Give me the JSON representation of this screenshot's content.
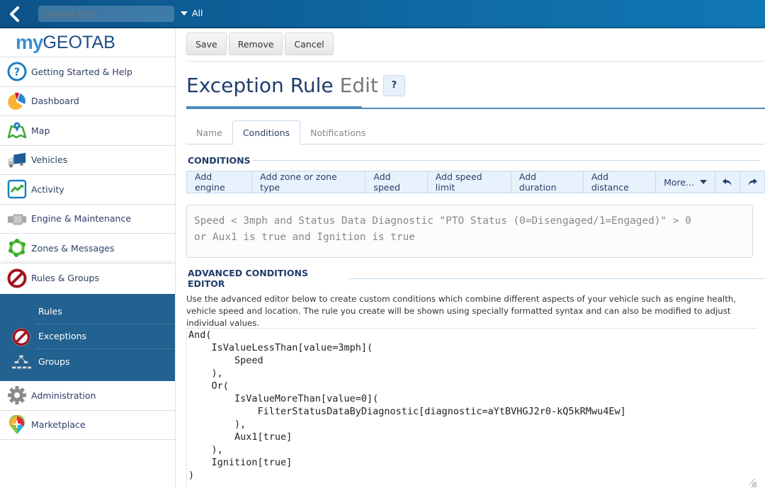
{
  "topbar": {
    "groups_filter_placeholder": "Groups filter",
    "all_label": "All",
    "back_icon": "chevron-left-icon"
  },
  "sidebar": {
    "logo": {
      "my": "my",
      "geotab": "GEOTAB"
    },
    "items": [
      {
        "label": "Getting Started & Help",
        "icon": "help-circle-icon"
      },
      {
        "label": "Dashboard",
        "icon": "pie-chart-icon"
      },
      {
        "label": "Map",
        "icon": "map-pin-icon"
      },
      {
        "label": "Vehicles",
        "icon": "truck-icon"
      },
      {
        "label": "Activity",
        "icon": "activity-chart-icon"
      },
      {
        "label": "Engine & Maintenance",
        "icon": "engine-icon"
      },
      {
        "label": "Zones & Messages",
        "icon": "zone-icon"
      },
      {
        "label": "Rules & Groups",
        "icon": "prohibited-icon"
      }
    ],
    "subitems": [
      {
        "label": "Rules",
        "icon": ""
      },
      {
        "label": "Exceptions",
        "icon": "prohibited-icon"
      },
      {
        "label": "Groups",
        "icon": "hierarchy-icon"
      }
    ],
    "bottom_items": [
      {
        "label": "Administration",
        "icon": "gear-icon"
      },
      {
        "label": "Marketplace",
        "icon": "marketplace-icon"
      }
    ]
  },
  "toolbar": {
    "save_label": "Save",
    "remove_label": "Remove",
    "cancel_label": "Cancel"
  },
  "page": {
    "title": "Exception Rule",
    "title_suffix": "Edit",
    "help_label": "?"
  },
  "tabs": [
    {
      "label": "Name",
      "active": false
    },
    {
      "label": "Conditions",
      "active": true
    },
    {
      "label": "Notifications",
      "active": false
    }
  ],
  "conditions": {
    "heading": "CONDITIONS",
    "buttons": [
      "Add engine",
      "Add zone or zone type",
      "Add speed",
      "Add speed limit",
      "Add duration",
      "Add distance",
      "More..."
    ],
    "undo_icon": "undo-icon",
    "redo_icon": "redo-icon",
    "summary_line1": "Speed < 3mph and Status Data Diagnostic \"PTO Status (0=Disengaged/1=Engaged)\" > 0",
    "summary_line2": "or Aux1 is true and Ignition is true"
  },
  "advanced": {
    "heading": "ADVANCED CONDITIONS EDITOR",
    "description": "Use the advanced editor below to create custom conditions which combine different aspects of your vehicle such as engine health, vehicle speed and location. The rule you create will be shown using specially formatted syntax and can also be modified to adjust individual values.",
    "code": "And(\n    IsValueLessThan[value=3mph](\n        Speed\n    ),\n    Or(\n        IsValueMoreThan[value=0](\n            FilterStatusDataByDiagnostic[diagnostic=aYtBVHGJ2r0-kQ5kRMwu4Ew]\n        ),\n        Aux1[true]\n    ),\n    Ignition[true]\n)"
  },
  "colors": {
    "topbar": "#0f6ba5",
    "sidebar_active": "#226190",
    "title": "#1f3d6b",
    "accent_line": "#4a8cc0",
    "condition_bar_bg": "#e8f2fc"
  }
}
